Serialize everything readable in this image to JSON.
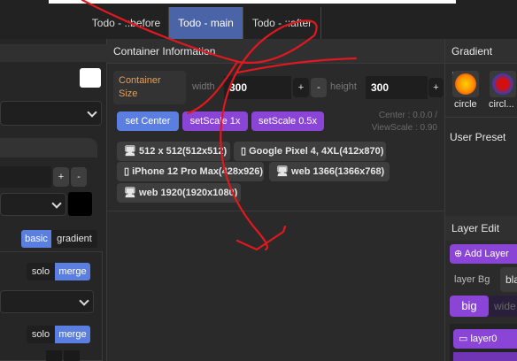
{
  "tabs": [
    {
      "label": "Todo - ::before"
    },
    {
      "label": "Todo - main"
    },
    {
      "label": "Todo - ::after"
    }
  ],
  "left": {
    "basic": "basic",
    "gradient": "gradient",
    "solo": "solo",
    "merge": "merge",
    "plus": "+",
    "minus": "-"
  },
  "container": {
    "title": "Container Information",
    "size_label": "Container\nSize",
    "width_label": "width",
    "width_value": "300",
    "height_label": "height",
    "height_value": "300",
    "plus": "+",
    "minus": "-",
    "set_center": "set Center",
    "set_scale_1": "setScale 1x",
    "set_scale_05": "setScale 0.5x",
    "center_text": "Center : 0.0.0 /",
    "viewscale_text": "ViewScale : 0.90",
    "presets": [
      {
        "label": "512 x 512(512x512)",
        "icon": "monitor-icon"
      },
      {
        "label": "Google Pixel 4, 4XL(412x870)",
        "icon": "phone-icon"
      },
      {
        "label": "iPhone 12 Pro Max(428x926)",
        "icon": "phone-icon"
      },
      {
        "label": "web 1366(1366x768)",
        "icon": "monitor-icon"
      },
      {
        "label": "web 1920(1920x1080)",
        "icon": "monitor-icon"
      }
    ]
  },
  "right": {
    "gradient_title": "Gradient Prese",
    "circle_label": "circle",
    "circle2_label": "circl...",
    "user_preset": "User Preset",
    "layer_edit": "Layer Edit",
    "add_layer": "Add Layer",
    "layer_bg": "layer Bg",
    "bg_value": "bla",
    "big": "big",
    "wide": "wide",
    "layer0": "layer0"
  },
  "colors": {
    "accent_blue": "#5a7fe0",
    "accent_purple": "#8a45d6",
    "scribble": "#e0181f"
  }
}
